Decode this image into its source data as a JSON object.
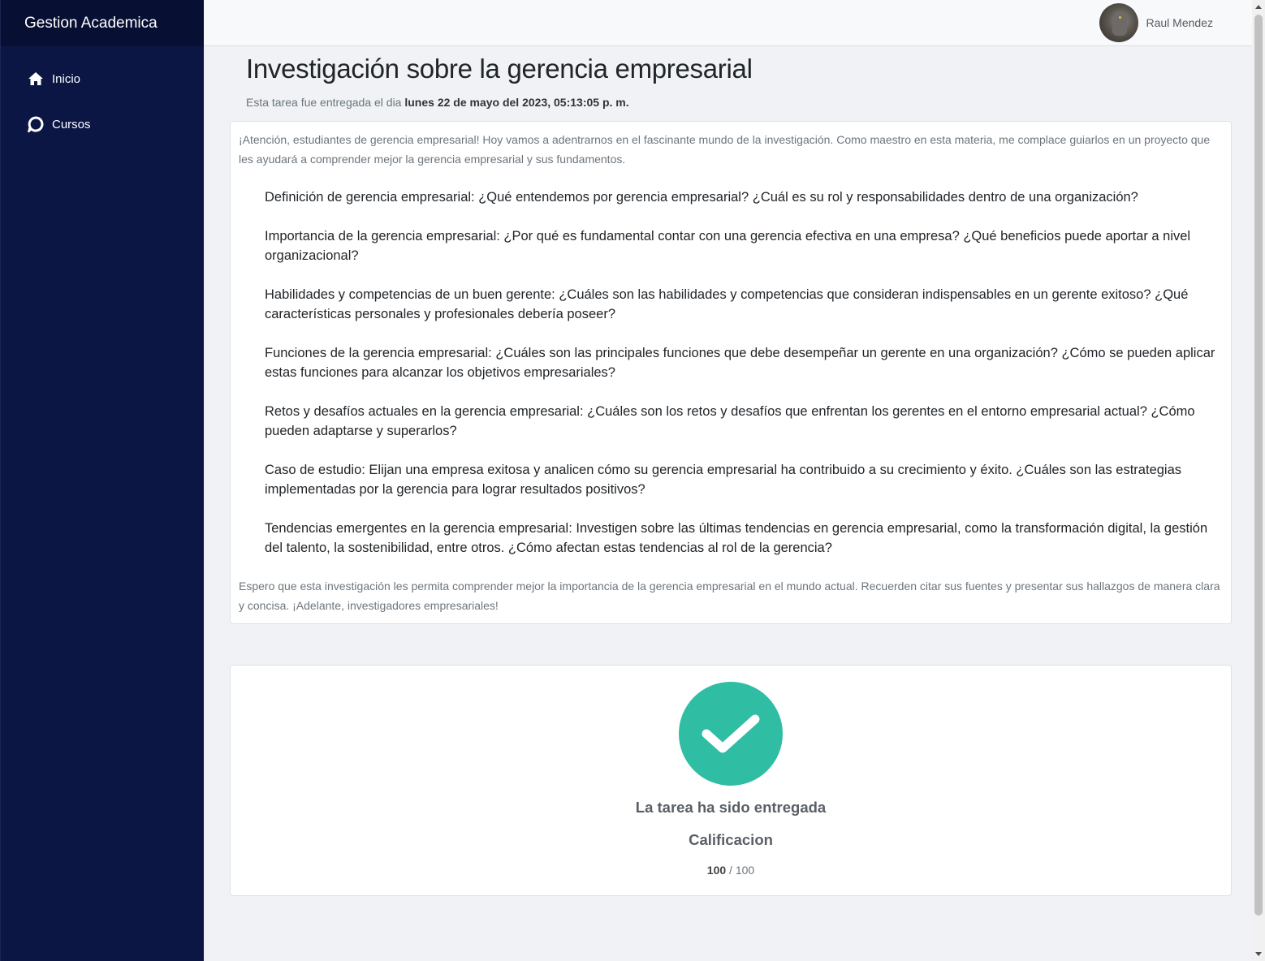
{
  "sidebar": {
    "brand": "Gestion Academica",
    "items": [
      {
        "label": "Inicio",
        "icon": "home-icon"
      },
      {
        "label": "Cursos",
        "icon": "chat-bubble-icon"
      }
    ]
  },
  "header": {
    "user_name": "Raul Mendez"
  },
  "assignment": {
    "title": "Investigación sobre la gerencia empresarial",
    "submitted_prefix": "Esta tarea fue entregada el dia",
    "submitted_date": "lunes 22 de mayo del 2023, 05:13:05 p. m.",
    "intro": "¡Atención, estudiantes de gerencia empresarial! Hoy vamos a adentrarnos en el fascinante mundo de la investigación. Como maestro en esta materia, me complace guiarlos en un proyecto que les ayudará a comprender mejor la gerencia empresarial y sus fundamentos.",
    "points": [
      "Definición de gerencia empresarial: ¿Qué entendemos por gerencia empresarial? ¿Cuál es su rol y responsabilidades dentro de una organización?",
      "Importancia de la gerencia empresarial: ¿Por qué es fundamental contar con una gerencia efectiva en una empresa? ¿Qué beneficios puede aportar a nivel organizacional?",
      "Habilidades y competencias de un buen gerente: ¿Cuáles son las habilidades y competencias que consideran indispensables en un gerente exitoso? ¿Qué características personales y profesionales debería poseer?",
      "Funciones de la gerencia empresarial: ¿Cuáles son las principales funciones que debe desempeñar un gerente en una organización? ¿Cómo se pueden aplicar estas funciones para alcanzar los objetivos empresariales?",
      "Retos y desafíos actuales en la gerencia empresarial: ¿Cuáles son los retos y desafíos que enfrentan los gerentes en el entorno empresarial actual? ¿Cómo pueden adaptarse y superarlos?",
      "Caso de estudio: Elijan una empresa exitosa y analicen cómo su gerencia empresarial ha contribuido a su crecimiento y éxito. ¿Cuáles son las estrategias implementadas por la gerencia para lograr resultados positivos?",
      "Tendencias emergentes en la gerencia empresarial: Investigen sobre las últimas tendencias en gerencia empresarial, como la transformación digital, la gestión del talento, la sostenibilidad, entre otros. ¿Cómo afectan estas tendencias al rol de la gerencia?"
    ],
    "outro": "Espero que esta investigación les permita comprender mejor la importancia de la gerencia empresarial en el mundo actual. Recuerden citar sus fuentes y presentar sus hallazgos de manera clara y concisa. ¡Adelante, investigadores empresariales!"
  },
  "status": {
    "icon": "check-circle-icon",
    "message": "La tarea ha sido entregada",
    "grade_label": "Calificacion",
    "score": "100",
    "separator": " / ",
    "max_score": "100",
    "accent_color": "#2fbda4"
  },
  "colors": {
    "sidebar": "#0b1644",
    "brand_bar": "#070f33",
    "background": "#f0f2f5"
  }
}
